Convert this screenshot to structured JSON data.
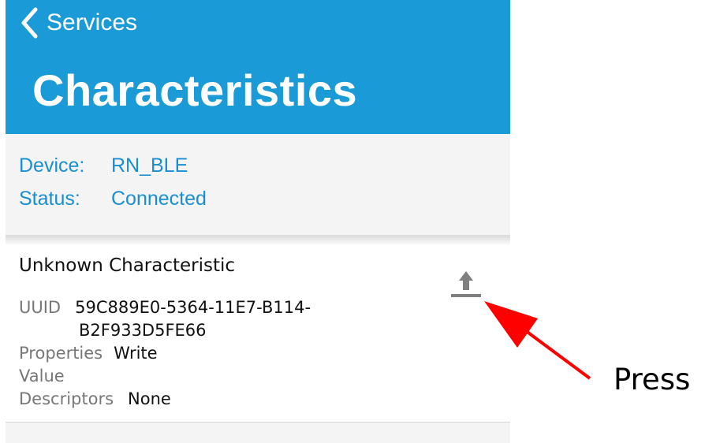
{
  "navbar": {
    "back_label": "Services",
    "title": "Characteristics",
    "color": "#1a9ad6"
  },
  "device": {
    "device_label": "Device:",
    "device_value": "RN_BLE",
    "status_label": "Status:",
    "status_value": "Connected"
  },
  "characteristic": {
    "name": "Unknown Characteristic",
    "uuid_label": "UUID",
    "uuid_line1": "59C889E0-5364-11E7-B114-",
    "uuid_line2": "B2F933D5FE66",
    "properties_label": "Properties",
    "properties_value": "Write",
    "value_label": "Value",
    "descriptors_label": "Descriptors",
    "descriptors_value": "None",
    "action_icon": "upload-icon"
  },
  "annotation": {
    "text": "Press",
    "color": "#ff0000"
  }
}
